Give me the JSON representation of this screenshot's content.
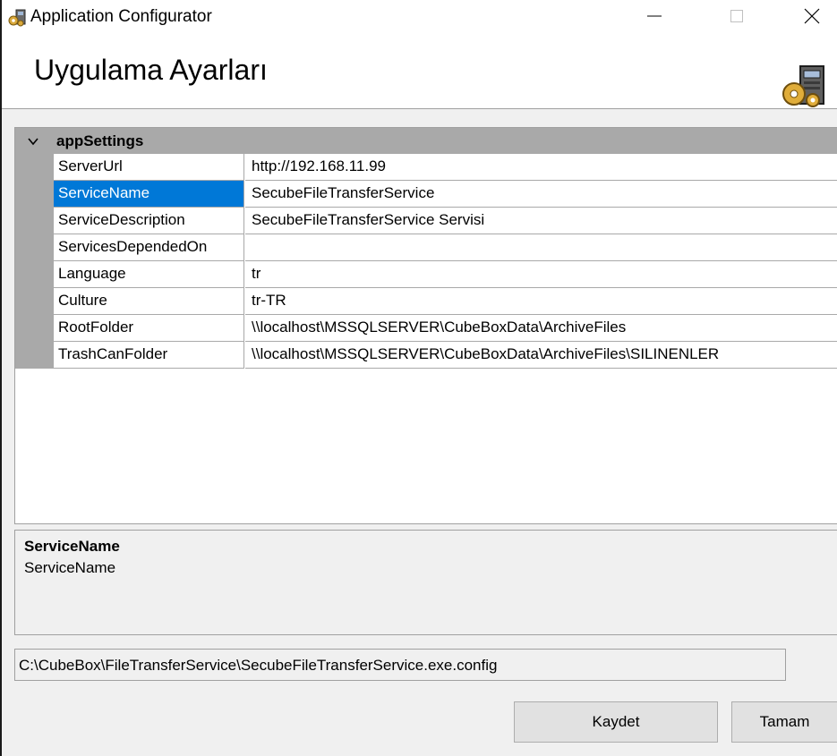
{
  "window": {
    "title": "Application Configurator",
    "icons": {
      "app": "gear-computer-icon",
      "minimize": "minimize-icon",
      "maximize": "maximize-icon",
      "close": "close-icon"
    }
  },
  "header": {
    "title": "Uygulama Ayarları",
    "icon": "gear-computer-icon"
  },
  "property_grid": {
    "category": {
      "label": "appSettings",
      "expanded": true,
      "icon": "chevron-down-icon"
    },
    "selected_index": 1,
    "rows": [
      {
        "name": "ServerUrl",
        "value": "http://192.168.11.99"
      },
      {
        "name": "ServiceName",
        "value": "SecubeFileTransferService"
      },
      {
        "name": "ServiceDescription",
        "value": "SecubeFileTransferService Servisi"
      },
      {
        "name": "ServicesDependedOn",
        "value": ""
      },
      {
        "name": "Language",
        "value": "tr"
      },
      {
        "name": "Culture",
        "value": "tr-TR"
      },
      {
        "name": "RootFolder",
        "value": "\\\\localhost\\MSSQLSERVER\\CubeBoxData\\ArchiveFiles"
      },
      {
        "name": "TrashCanFolder",
        "value": "\\\\localhost\\MSSQLSERVER\\CubeBoxData\\ArchiveFiles\\SILINENLER"
      }
    ]
  },
  "description": {
    "title": "ServiceName",
    "text": "ServiceName"
  },
  "config_path": "C:\\CubeBox\\FileTransferService\\SecubeFileTransferService.exe.config",
  "buttons": {
    "save": "Kaydet",
    "ok": "Tamam"
  },
  "colors": {
    "selection": "#0078d7",
    "category_bg": "#a9a9a9",
    "window_bg": "#f0f0f0"
  }
}
